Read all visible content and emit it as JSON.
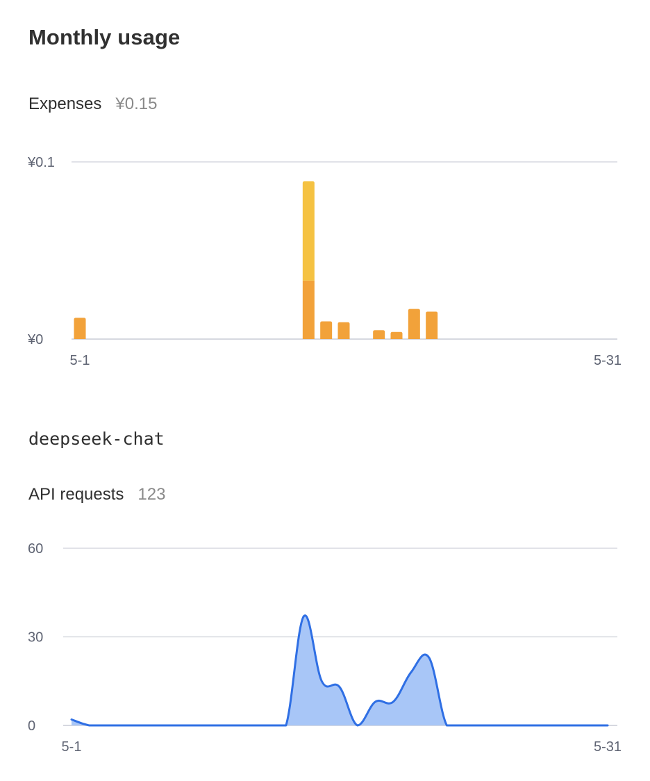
{
  "page": {
    "title": "Monthly usage"
  },
  "expenses": {
    "label": "Expenses",
    "total": "¥0.15"
  },
  "model": {
    "name": "deepseek-chat"
  },
  "requests": {
    "label": "API requests",
    "total": "123"
  },
  "colors": {
    "grid": "#d7d9e0",
    "axis": "#c9ccd6",
    "bar_primary": "#f2a23a",
    "bar_secondary": "#f5c242",
    "line": "#2f6fe4",
    "area": "#a8c6f7"
  },
  "chart_data": [
    {
      "type": "bar",
      "stacked": true,
      "title": "",
      "xlabel": "",
      "ylabel": "",
      "x_tick_labels": [
        "5-1",
        "5-31"
      ],
      "y_tick_labels": [
        "¥0",
        "¥0.1"
      ],
      "ylim": [
        0,
        0.1
      ],
      "grid": true,
      "categories": [
        "5-1",
        "5-2",
        "5-3",
        "5-4",
        "5-5",
        "5-6",
        "5-7",
        "5-8",
        "5-9",
        "5-10",
        "5-11",
        "5-12",
        "5-13",
        "5-14",
        "5-15",
        "5-16",
        "5-17",
        "5-18",
        "5-19",
        "5-20",
        "5-21",
        "5-22",
        "5-23",
        "5-24",
        "5-25",
        "5-26",
        "5-27",
        "5-28",
        "5-29",
        "5-30",
        "5-31"
      ],
      "series": [
        {
          "color": "#f2a23a",
          "values": [
            0.012,
            0,
            0,
            0,
            0,
            0,
            0,
            0,
            0,
            0,
            0,
            0,
            0,
            0.033,
            0.01,
            0.0095,
            0,
            0.005,
            0.004,
            0.017,
            0.0155,
            0,
            0,
            0,
            0,
            0,
            0,
            0,
            0,
            0,
            0
          ]
        },
        {
          "color": "#f5c242",
          "values": [
            0,
            0,
            0,
            0,
            0,
            0,
            0,
            0,
            0,
            0,
            0,
            0,
            0,
            0.056,
            0,
            0,
            0,
            0,
            0,
            0,
            0,
            0,
            0,
            0,
            0,
            0,
            0,
            0,
            0,
            0,
            0
          ]
        }
      ]
    },
    {
      "type": "area",
      "title": "",
      "xlabel": "",
      "ylabel": "",
      "x_tick_labels": [
        "5-1",
        "5-31"
      ],
      "y_tick_labels": [
        "0",
        "30",
        "60"
      ],
      "ylim": [
        0,
        60
      ],
      "grid": true,
      "categories": [
        "5-1",
        "5-2",
        "5-3",
        "5-4",
        "5-5",
        "5-6",
        "5-7",
        "5-8",
        "5-9",
        "5-10",
        "5-11",
        "5-12",
        "5-13",
        "5-14",
        "5-15",
        "5-16",
        "5-17",
        "5-18",
        "5-19",
        "5-20",
        "5-21",
        "5-22",
        "5-23",
        "5-24",
        "5-25",
        "5-26",
        "5-27",
        "5-28",
        "5-29",
        "5-30",
        "5-31"
      ],
      "series": [
        {
          "color": "#2f6fe4",
          "values": [
            2,
            0,
            0,
            0,
            0,
            0,
            0,
            0,
            0,
            0,
            0,
            0,
            0,
            37,
            15,
            13,
            0,
            8,
            8,
            18,
            23,
            0,
            0,
            0,
            0,
            0,
            0,
            0,
            0,
            0,
            0
          ]
        }
      ]
    }
  ]
}
